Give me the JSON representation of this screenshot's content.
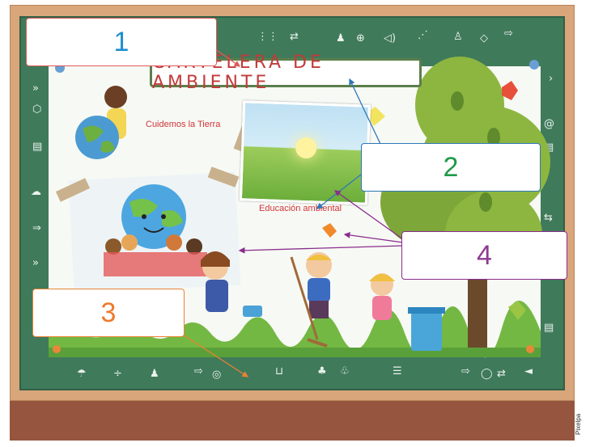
{
  "poster": {
    "title": "CARTELERA DE AMBIENTE",
    "caption_tierra": "Cuidemos la Tierra",
    "caption_educacion": "Educación ambiental"
  },
  "label_boxes": [
    {
      "number": "1",
      "color": "#1f8ed1"
    },
    {
      "number": "2",
      "color": "#1d9a48"
    },
    {
      "number": "3",
      "color": "#ef7a2d"
    },
    {
      "number": "4",
      "color": "#8e3b8e"
    }
  ],
  "credit": "Pixelpa",
  "board_icons": [
    "arrow-icon",
    "person-icon",
    "speaker-icon",
    "share-icon",
    "document-icon",
    "mail-icon",
    "at-icon",
    "cloud-icon",
    "tree-icon",
    "chat-icon"
  ],
  "colors": {
    "board": "#3f7a5b",
    "frame": "#d9a57a",
    "frame_bottom": "#95553e",
    "title_text": "#c23a3a"
  }
}
